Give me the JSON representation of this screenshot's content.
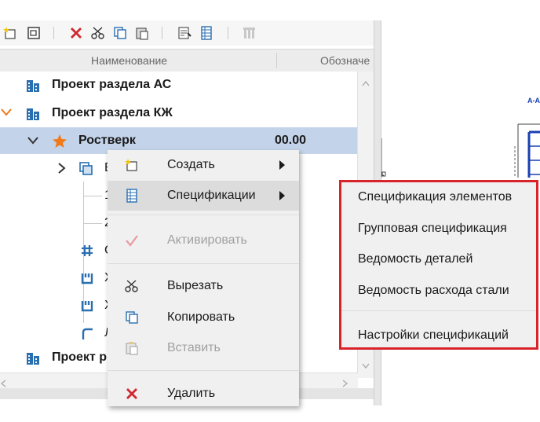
{
  "toolbar": {
    "buttons": [
      "new-item-icon",
      "view-icon",
      "delete-icon",
      "cut-icon",
      "copy-icon",
      "paste-icon",
      "properties-icon",
      "specification-icon",
      "columns-icon"
    ]
  },
  "columns": {
    "name": "Наименование",
    "designation": "Обозначе"
  },
  "tree": {
    "row1": {
      "label": "Проект раздела АС"
    },
    "row2": {
      "label": "Проект раздела КЖ"
    },
    "row3": {
      "label": "Ростверк",
      "value": "00.00"
    },
    "row4": {
      "label": "Б"
    },
    "row5": {
      "label": "1"
    },
    "row6": {
      "label": "2"
    },
    "row7": {
      "label": "С"
    },
    "row8": {
      "label": "Х"
    },
    "row9": {
      "label": "Х"
    },
    "row10": {
      "label": "Л"
    },
    "row11": {
      "label": "Проект р"
    }
  },
  "drawing": {
    "label": "А-А"
  },
  "context_menu": {
    "create": "Создать",
    "specs": "Спецификации",
    "activate": "Активировать",
    "cut": "Вырезать",
    "copy": "Копировать",
    "paste": "Вставить",
    "delete": "Удалить"
  },
  "submenu": {
    "item1": "Спецификация элементов",
    "item2": "Групповая спецификация",
    "item3": "Ведомость деталей",
    "item4": "Ведомость расхода стали",
    "item5": "Настройки спецификаций"
  },
  "colors": {
    "accent_red": "#d9232b",
    "icon_blue": "#2a6fb0",
    "selection": "#c3d3e9",
    "star": "#f07a1a"
  }
}
